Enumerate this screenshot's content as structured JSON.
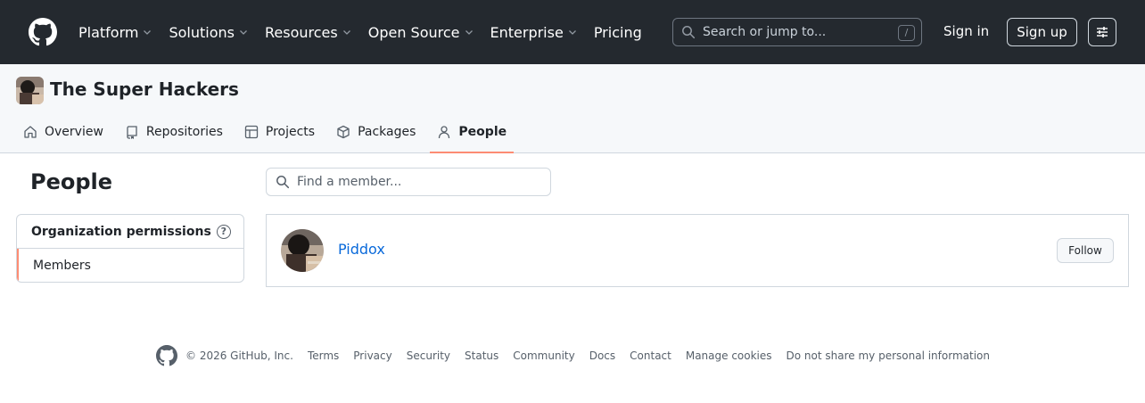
{
  "header": {
    "nav": [
      {
        "label": "Platform",
        "has_dropdown": true
      },
      {
        "label": "Solutions",
        "has_dropdown": true
      },
      {
        "label": "Resources",
        "has_dropdown": true
      },
      {
        "label": "Open Source",
        "has_dropdown": true
      },
      {
        "label": "Enterprise",
        "has_dropdown": true
      },
      {
        "label": "Pricing",
        "has_dropdown": false
      }
    ],
    "search_placeholder": "Search or jump to...",
    "search_shortcut": "/",
    "sign_in": "Sign in",
    "sign_up": "Sign up"
  },
  "org": {
    "name": "The Super Hackers",
    "tabs": [
      {
        "label": "Overview",
        "icon": "home-icon",
        "active": false
      },
      {
        "label": "Repositories",
        "icon": "repo-icon",
        "active": false
      },
      {
        "label": "Projects",
        "icon": "project-table-icon",
        "active": false
      },
      {
        "label": "Packages",
        "icon": "package-icon",
        "active": false
      },
      {
        "label": "People",
        "icon": "person-icon",
        "active": true
      }
    ]
  },
  "sidebar": {
    "page_title": "People",
    "section_title": "Organization permissions",
    "help_icon": "?",
    "items": [
      {
        "label": "Members",
        "active": true
      }
    ]
  },
  "main": {
    "find_placeholder": "Find a member...",
    "members": [
      {
        "name": "Piddox",
        "follow_label": "Follow"
      }
    ]
  },
  "footer": {
    "copyright": "© 2026 GitHub, Inc.",
    "links": [
      "Terms",
      "Privacy",
      "Security",
      "Status",
      "Community",
      "Docs",
      "Contact",
      "Manage cookies",
      "Do not share my personal information"
    ]
  },
  "colors": {
    "header_bg": "#24292f",
    "accent_underline": "#fd8c73",
    "link_blue": "#0969da"
  }
}
